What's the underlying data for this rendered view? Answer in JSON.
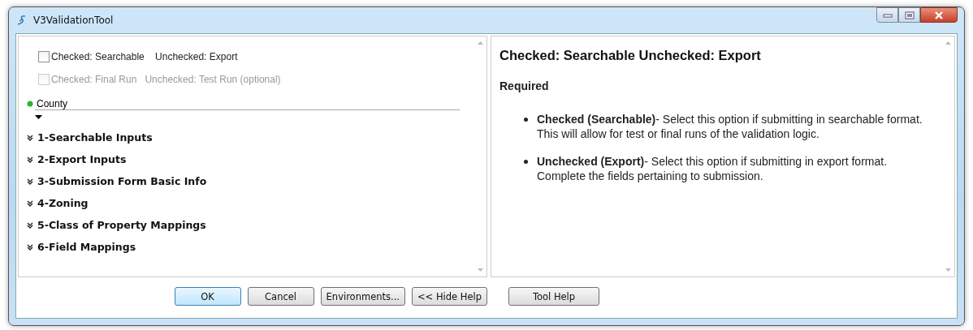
{
  "window": {
    "title": "V3ValidationTool"
  },
  "options": [
    {
      "label": "Checked: Searchable    Unchecked: Export",
      "checked": false,
      "disabled": false
    },
    {
      "label": "Checked: Final Run   Unchecked: Test Run (optional)",
      "checked": false,
      "disabled": true
    }
  ],
  "county": {
    "label": "County",
    "required": true
  },
  "sections": [
    {
      "label": "1-Searchable Inputs",
      "expanded": false
    },
    {
      "label": "2-Export Inputs",
      "expanded": false
    },
    {
      "label": "3-Submission Form Basic Info",
      "expanded": false
    },
    {
      "label": "4-Zoning",
      "expanded": false
    },
    {
      "label": "5-Class of Property Mappings",
      "expanded": false
    },
    {
      "label": "6-Field Mappings",
      "expanded": false
    }
  ],
  "help": {
    "title": "Checked: Searchable Unchecked: Export",
    "subtitle": "Required",
    "bullets": [
      {
        "term": "Checked (Searchable)",
        "text": "- Select this option if submitting in searchable format. This will allow for test or final runs of the validation logic."
      },
      {
        "term": "Unchecked (Export)",
        "text": "- Select this option if submitting in export format. Complete the fields pertaining to submission."
      }
    ]
  },
  "buttons": [
    {
      "label": "OK",
      "default": true
    },
    {
      "label": "Cancel",
      "default": false
    },
    {
      "label": "Environments...",
      "default": false
    },
    {
      "label": "<< Hide Help",
      "default": false
    }
  ],
  "help_button": {
    "label": "Tool Help"
  }
}
